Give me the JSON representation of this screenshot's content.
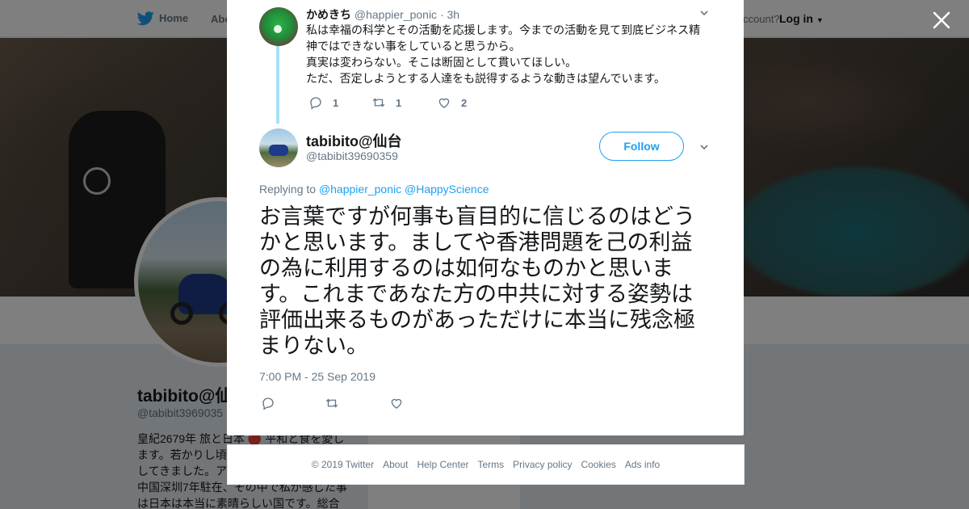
{
  "nav": {
    "home_label": "Home",
    "about_label": "Abo",
    "account_text": "ccount?",
    "login_label": "Log in"
  },
  "profile": {
    "name": "tabibito@仙",
    "handle": "@tabibit3969035",
    "bio_lines": [
      "皇紀2679年 旅と日本 🔴 平和と食を愛し",
      "ます。若かりし頃",
      "してきました。ア",
      "中国深圳7年駐在、その中で私が感じた事",
      "は日本は本当に素晴らしい国です。総合"
    ]
  },
  "reply_tweet": {
    "name": "かめきち",
    "handle": "@happier_ponic",
    "time": "3h",
    "text_lines": [
      "私は幸福の科学とその活動を応援します。今までの活動を見て到底ビジネス精",
      "神ではできない事をしていると思うから。",
      "真実は変わらない。そこは断固として貫いてほしい。",
      "ただ、否定しようとする人達をも説得するような動きは望んでいます。"
    ],
    "reply_count": "1",
    "retweet_count": "1",
    "like_count": "2"
  },
  "main_tweet": {
    "name": "tabibito@仙台",
    "handle": "@tabibit39690359",
    "follow_label": "Follow",
    "replying_prefix": "Replying to",
    "replying_to": [
      "@happier_ponic",
      "@HappyScience"
    ],
    "text_lines": [
      "お言葉ですが何事も盲目的に信じるのはどう",
      "かと思います。ましてや香港問題を己の利益",
      "の為に利用するのは如何なものかと思いま",
      "す。これまであなた方の中共に対する姿勢は",
      "評価出来るものがあっただけに本当に残念極",
      "まりない。"
    ],
    "timestamp": "7:00 PM - 25 Sep 2019"
  },
  "footer": {
    "items": [
      "© 2019 Twitter",
      "About",
      "Help Center",
      "Terms",
      "Privacy policy",
      "Cookies",
      "Ads info"
    ]
  },
  "colors": {
    "accent": "#1da1f2",
    "secondary_text": "#657786",
    "thread_line": "#a9dff8"
  },
  "icons": [
    "twitter-bird-icon",
    "close-icon",
    "chevron-down-icon",
    "reply-icon",
    "retweet-icon",
    "like-icon"
  ]
}
